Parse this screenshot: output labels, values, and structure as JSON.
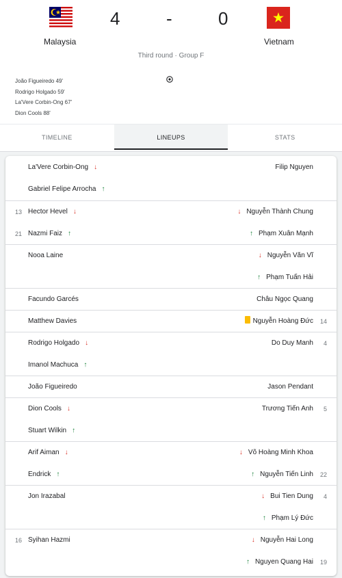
{
  "match": {
    "home_team": "Malaysia",
    "away_team": "Vietnam",
    "home_score": "4",
    "separator": "-",
    "away_score": "0",
    "info": "Third round · Group F"
  },
  "scorers": [
    "João Figueiredo 49'",
    "Rodrigo Holgado 59'",
    "La'Vere Corbin-Ong 67'",
    "Dion Cools 88'"
  ],
  "tabs": [
    {
      "label": "TIMELINE",
      "active": false
    },
    {
      "label": "LINEUPS",
      "active": true
    },
    {
      "label": "STATS",
      "active": false
    }
  ],
  "lineups": [
    {
      "rows": [
        {
          "left_num": "",
          "left": "La'Vere Corbin-Ong",
          "left_event": "sub-out",
          "right": "Filip Nguyen",
          "right_event": "",
          "right_num": ""
        },
        {
          "left_num": "",
          "left": "Gabriel Felipe Arrocha",
          "left_event": "sub-in",
          "right": "",
          "right_event": "",
          "right_num": ""
        }
      ]
    },
    {
      "rows": [
        {
          "left_num": "13",
          "left": "Hector Hevel",
          "left_event": "sub-out",
          "right": "Nguyễn Thành Chung",
          "right_event": "sub-out",
          "right_num": ""
        },
        {
          "left_num": "21",
          "left": "Nazmi Faiz",
          "left_event": "sub-in",
          "right": "Phạm Xuân Mạnh",
          "right_event": "sub-in",
          "right_num": ""
        }
      ]
    },
    {
      "rows": [
        {
          "left_num": "",
          "left": "Nooa Laine",
          "left_event": "",
          "right": "Nguyễn Văn Vĩ",
          "right_event": "sub-out",
          "right_num": ""
        },
        {
          "left_num": "",
          "left": "",
          "left_event": "",
          "right": "Phạm Tuấn Hải",
          "right_event": "sub-in",
          "right_num": ""
        }
      ]
    },
    {
      "rows": [
        {
          "left_num": "",
          "left": "Facundo Garcés",
          "left_event": "",
          "right": "Châu Ngọc Quang",
          "right_event": "",
          "right_num": ""
        }
      ]
    },
    {
      "rows": [
        {
          "left_num": "",
          "left": "Matthew Davies",
          "left_event": "",
          "right": "Nguyễn Hoàng Đức",
          "right_event": "yellow-card",
          "right_num": "14"
        }
      ]
    },
    {
      "rows": [
        {
          "left_num": "",
          "left": "Rodrigo Holgado",
          "left_event": "sub-out",
          "right": "Do Duy Manh",
          "right_event": "",
          "right_num": "4"
        },
        {
          "left_num": "",
          "left": "Imanol Machuca",
          "left_event": "sub-in",
          "right": "",
          "right_event": "",
          "right_num": ""
        }
      ]
    },
    {
      "rows": [
        {
          "left_num": "",
          "left": "João Figueiredo",
          "left_event": "",
          "right": "Jason Pendant",
          "right_event": "",
          "right_num": ""
        }
      ]
    },
    {
      "rows": [
        {
          "left_num": "",
          "left": "Dion Cools",
          "left_event": "sub-out",
          "right": "Trương Tiến Anh",
          "right_event": "",
          "right_num": "5"
        },
        {
          "left_num": "",
          "left": "Stuart Wilkin",
          "left_event": "sub-in",
          "right": "",
          "right_event": "",
          "right_num": ""
        }
      ]
    },
    {
      "rows": [
        {
          "left_num": "",
          "left": "Arif Aiman",
          "left_event": "sub-out",
          "right": "Võ Hoàng Minh Khoa",
          "right_event": "sub-out",
          "right_num": ""
        },
        {
          "left_num": "",
          "left": "Endrick",
          "left_event": "sub-in",
          "right": "Nguyễn Tiến Linh",
          "right_event": "sub-in",
          "right_num": "22"
        }
      ]
    },
    {
      "rows": [
        {
          "left_num": "",
          "left": "Jon Irazabal",
          "left_event": "",
          "right": "Bui Tien Dung",
          "right_event": "sub-out",
          "right_num": "4"
        },
        {
          "left_num": "",
          "left": "",
          "left_event": "",
          "right": "Phạm Lý Đức",
          "right_event": "sub-in",
          "right_num": ""
        }
      ]
    },
    {
      "rows": [
        {
          "left_num": "16",
          "left": "Syihan Hazmi",
          "left_event": "",
          "right": "Nguyễn Hai Long",
          "right_event": "sub-out",
          "right_num": ""
        },
        {
          "left_num": "",
          "left": "",
          "left_event": "",
          "right": "Nguyen Quang Hai",
          "right_event": "sub-in",
          "right_num": "19"
        }
      ]
    }
  ],
  "icons": {
    "sub_out": "arrow-down-icon",
    "sub_in": "arrow-up-icon",
    "yellow_card": "yellow-card-icon",
    "goal": "soccer-ball-icon"
  },
  "colors": {
    "sub_out": "#d93025",
    "sub_in": "#188038",
    "yellow_card": "#fbbc04"
  }
}
